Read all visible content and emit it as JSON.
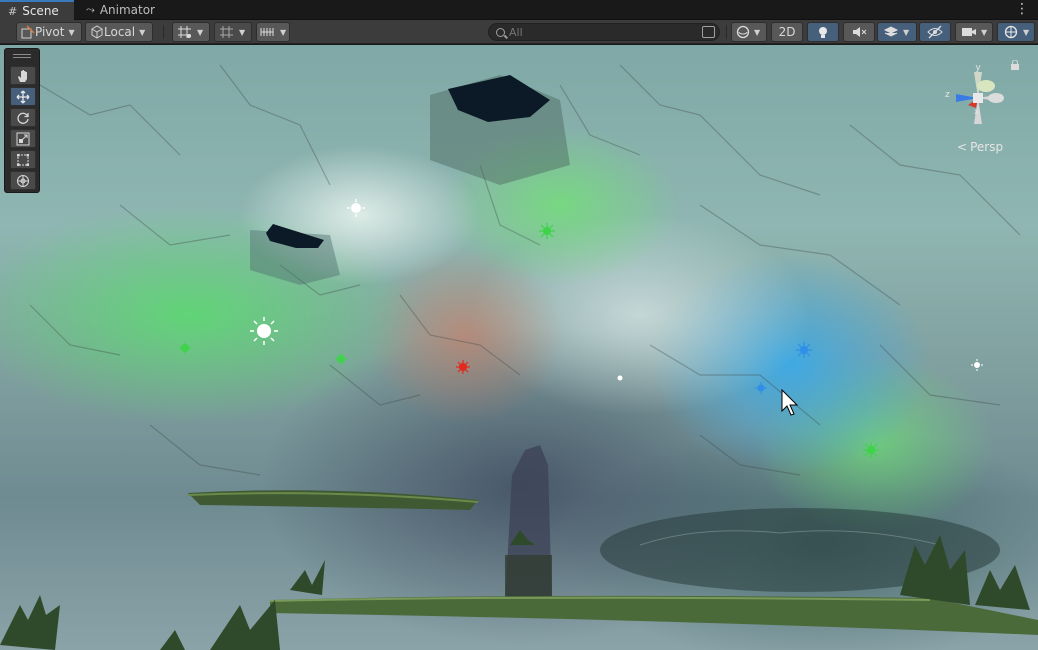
{
  "tabs": [
    {
      "label": "Scene",
      "icon": "grid-hash-icon",
      "active": true
    },
    {
      "label": "Animator",
      "icon": "animator-icon",
      "active": false
    }
  ],
  "toolbar": {
    "pivot_label": "Pivot",
    "local_label": "Local",
    "search_placeholder": "All",
    "two_d_label": "2D"
  },
  "viewport": {
    "projection_label": "Persp",
    "gizmo_axes": [
      "y",
      "z",
      "x"
    ]
  },
  "colors": {
    "accent": "#46607c",
    "light_green": "#3fd34a",
    "light_red": "#e02a1f",
    "light_blue": "#2f8fe8",
    "light_white": "#ffffff"
  }
}
